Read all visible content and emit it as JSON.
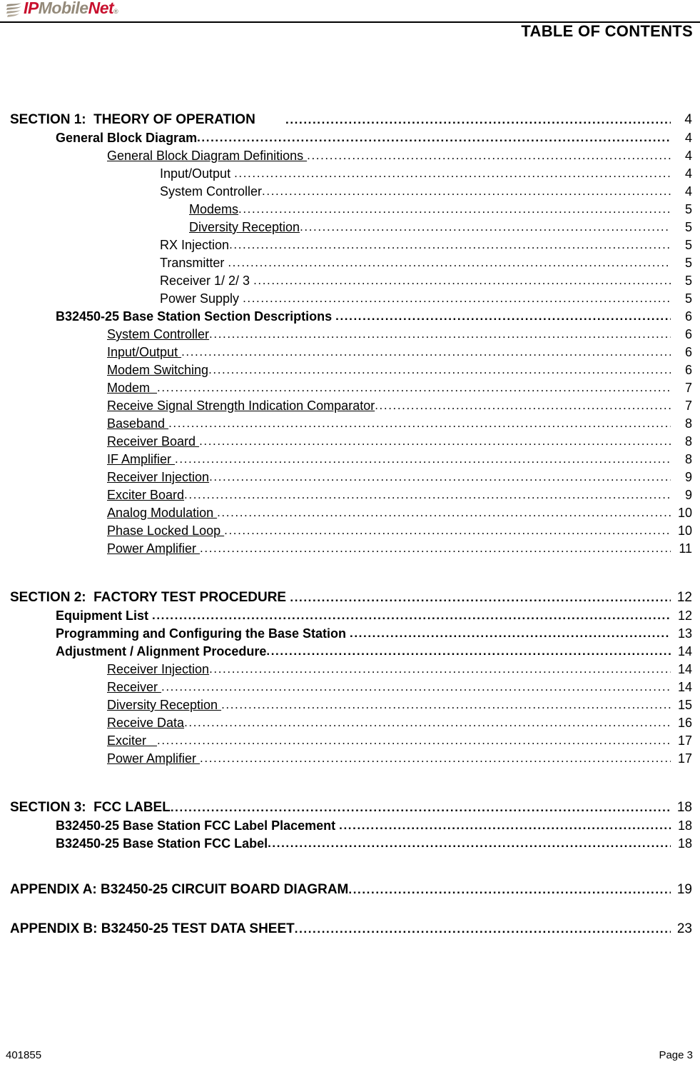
{
  "header": {
    "logo": {
      "ip": "IP",
      "mobile": "Mobile",
      "net": "Net",
      "tm": "®",
      "swoosh_color": "#948a7a",
      "red": "#c8102e",
      "gray": "#948a7a"
    },
    "title": "TABLE OF CONTENTS"
  },
  "toc": {
    "groups": [
      {
        "entries": [
          {
            "label": "SECTION 1:  THEORY OF OPERATION        ",
            "page": "4",
            "level": 1,
            "underline": false
          },
          {
            "label": "General Block Diagram",
            "page": "4",
            "level": 2,
            "underline": false
          },
          {
            "label": "General Block Diagram Definitions ",
            "page": "4",
            "level": 3,
            "underline": true
          },
          {
            "label": "Input/Output ",
            "page": "4",
            "level": 4,
            "underline": false
          },
          {
            "label": "System Controller",
            "page": "4",
            "level": 4,
            "underline": false
          },
          {
            "label": "Modems",
            "page": "5",
            "level": 5,
            "underline": true
          },
          {
            "label": "Diversity Reception",
            "page": "5",
            "level": 5,
            "underline": true
          },
          {
            "label": "RX Injection",
            "page": "5",
            "level": 4,
            "underline": false
          },
          {
            "label": "Transmitter ",
            "page": "5",
            "level": 4,
            "underline": false
          },
          {
            "label": "Receiver 1/ 2/ 3 ",
            "page": "5",
            "level": 4,
            "underline": false
          },
          {
            "label": "Power Supply ",
            "page": "5",
            "level": 4,
            "underline": false
          },
          {
            "label": "B32450-25 Base Station Section Descriptions ",
            "page": "6",
            "level": 2,
            "underline": false
          },
          {
            "label": "System Controller",
            "page": "6",
            "level": 3,
            "underline": true
          },
          {
            "label": "Input/Output ",
            "page": "6",
            "level": 3,
            "underline": true
          },
          {
            "label": "Modem Switching",
            "page": "6",
            "level": 3,
            "underline": true
          },
          {
            "label": "Modem  ",
            "page": "7",
            "level": 3,
            "underline": true
          },
          {
            "label": "Receive Signal Strength Indication Comparator",
            "page": "7",
            "level": 3,
            "underline": true
          },
          {
            "label": "Baseband ",
            "page": "8",
            "level": 3,
            "underline": true
          },
          {
            "label": "Receiver Board ",
            "page": "8",
            "level": 3,
            "underline": true
          },
          {
            "label": "IF Amplifier ",
            "page": "8",
            "level": 3,
            "underline": true
          },
          {
            "label": "Receiver Injection",
            "page": "9",
            "level": 3,
            "underline": true
          },
          {
            "label": "Exciter Board",
            "page": "9",
            "level": 3,
            "underline": true
          },
          {
            "label": "Analog Modulation ",
            "page": "10",
            "level": 3,
            "underline": true
          },
          {
            "label": "Phase Locked Loop ",
            "page": "10",
            "level": 3,
            "underline": true
          },
          {
            "label": "Power Amplifier ",
            "page": "11",
            "level": 3,
            "underline": true
          }
        ]
      },
      {
        "entries": [
          {
            "label": "SECTION 2:  FACTORY TEST PROCEDURE ",
            "page": "12",
            "level": 1,
            "underline": false
          },
          {
            "label": "Equipment List ",
            "page": "12",
            "level": 2,
            "underline": false
          },
          {
            "label": "Programming and Configuring the Base Station ",
            "page": "13",
            "level": 2,
            "underline": false
          },
          {
            "label": "Adjustment / Alignment Procedure",
            "page": "14",
            "level": 2,
            "underline": false
          },
          {
            "label": "Receiver Injection",
            "page": "14",
            "level": 3,
            "underline": true
          },
          {
            "label": "Receiver ",
            "page": "14",
            "level": 3,
            "underline": true
          },
          {
            "label": "Diversity Reception ",
            "page": "15",
            "level": 3,
            "underline": true
          },
          {
            "label": "Receive Data",
            "page": "16",
            "level": 3,
            "underline": true
          },
          {
            "label": "Exciter   ",
            "page": "17",
            "level": 3,
            "underline": true
          },
          {
            "label": "Power Amplifier ",
            "page": "17",
            "level": 3,
            "underline": true
          }
        ]
      },
      {
        "entries": [
          {
            "label": "SECTION 3:  FCC LABEL",
            "page": "18",
            "level": 1,
            "underline": false
          },
          {
            "label": "B32450-25 Base Station FCC Label Placement ",
            "page": "18",
            "level": 2,
            "underline": false
          },
          {
            "label": "B32450-25 Base Station FCC Label",
            "page": "18",
            "level": 2,
            "underline": false
          }
        ]
      },
      {
        "entries": [
          {
            "label": "APPENDIX A: B32450-25 CIRCUIT BOARD DIAGRAM",
            "page": "19",
            "level": 1,
            "underline": false
          }
        ]
      },
      {
        "entries": [
          {
            "label": "APPENDIX B: B32450-25 TEST DATA SHEET",
            "page": "23",
            "level": 1,
            "underline": false
          }
        ]
      }
    ]
  },
  "footer": {
    "doc_number": "401855",
    "page_label": "Page 3"
  }
}
